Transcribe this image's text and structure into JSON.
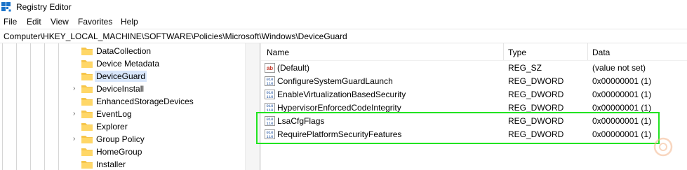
{
  "window": {
    "title": "Registry Editor"
  },
  "menu": [
    "File",
    "Edit",
    "View",
    "Favorites",
    "Help"
  ],
  "address": "Computer\\HKEY_LOCAL_MACHINE\\SOFTWARE\\Policies\\Microsoft\\Windows\\DeviceGuard",
  "tree": {
    "items": [
      {
        "label": "DataCollection",
        "expandable": false
      },
      {
        "label": "Device Metadata",
        "expandable": false
      },
      {
        "label": "DeviceGuard",
        "expandable": false,
        "selected": true
      },
      {
        "label": "DeviceInstall",
        "expandable": true
      },
      {
        "label": "EnhancedStorageDevices",
        "expandable": false
      },
      {
        "label": "EventLog",
        "expandable": true
      },
      {
        "label": "Explorer",
        "expandable": false
      },
      {
        "label": "Group Policy",
        "expandable": true
      },
      {
        "label": "HomeGroup",
        "expandable": false
      },
      {
        "label": "Installer",
        "expandable": false
      }
    ]
  },
  "columns": {
    "name": "Name",
    "type": "Type",
    "data": "Data"
  },
  "values": [
    {
      "name": "(Default)",
      "type": "REG_SZ",
      "data": "(value not set)",
      "icon": "string-value-icon"
    },
    {
      "name": "ConfigureSystemGuardLaunch",
      "type": "REG_DWORD",
      "data": "0x00000001 (1)",
      "icon": "binary-value-icon"
    },
    {
      "name": "EnableVirtualizationBasedSecurity",
      "type": "REG_DWORD",
      "data": "0x00000001 (1)",
      "icon": "binary-value-icon"
    },
    {
      "name": "HypervisorEnforcedCodeIntegrity",
      "type": "REG_DWORD",
      "data": "0x00000001 (1)",
      "icon": "binary-value-icon"
    },
    {
      "name": "LsaCfgFlags",
      "type": "REG_DWORD",
      "data": "0x00000001 (1)",
      "icon": "binary-value-icon"
    },
    {
      "name": "RequirePlatformSecurityFeatures",
      "type": "REG_DWORD",
      "data": "0x00000001 (1)",
      "icon": "binary-value-icon"
    }
  ],
  "colors": {
    "highlight_box": "#21e421",
    "selection": "#d8e6fb",
    "folder": "#f6c54a"
  }
}
